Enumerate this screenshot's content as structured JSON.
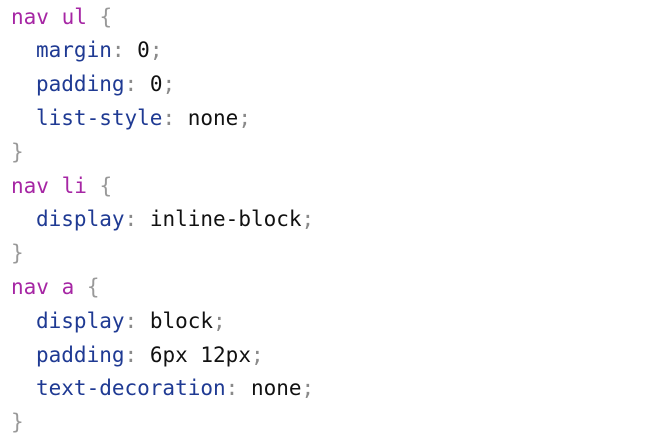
{
  "code": {
    "rules": [
      {
        "selector": "nav ul",
        "open": "{",
        "close": "}",
        "declarations": [
          {
            "property": "margin",
            "colon": ":",
            "value": "0",
            "semi": ";"
          },
          {
            "property": "padding",
            "colon": ":",
            "value": "0",
            "semi": ";"
          },
          {
            "property": "list-style",
            "colon": ":",
            "value": "none",
            "semi": ";"
          }
        ]
      },
      {
        "selector": "nav li",
        "open": "{",
        "close": "}",
        "declarations": [
          {
            "property": "display",
            "colon": ":",
            "value": "inline-block",
            "semi": ";"
          }
        ]
      },
      {
        "selector": "nav a",
        "open": "{",
        "close": "}",
        "declarations": [
          {
            "property": "display",
            "colon": ":",
            "value": "block",
            "semi": ";"
          },
          {
            "property": "padding",
            "colon": ":",
            "value": "6px 12px",
            "semi": ";"
          },
          {
            "property": "text-decoration",
            "colon": ":",
            "value": "none",
            "semi": ";"
          }
        ]
      }
    ]
  },
  "colors": {
    "selector": "#a626a4",
    "property": "#1f3a93",
    "punctuation": "#8a8a8a",
    "value": "#111111",
    "background": "#ffffff"
  }
}
